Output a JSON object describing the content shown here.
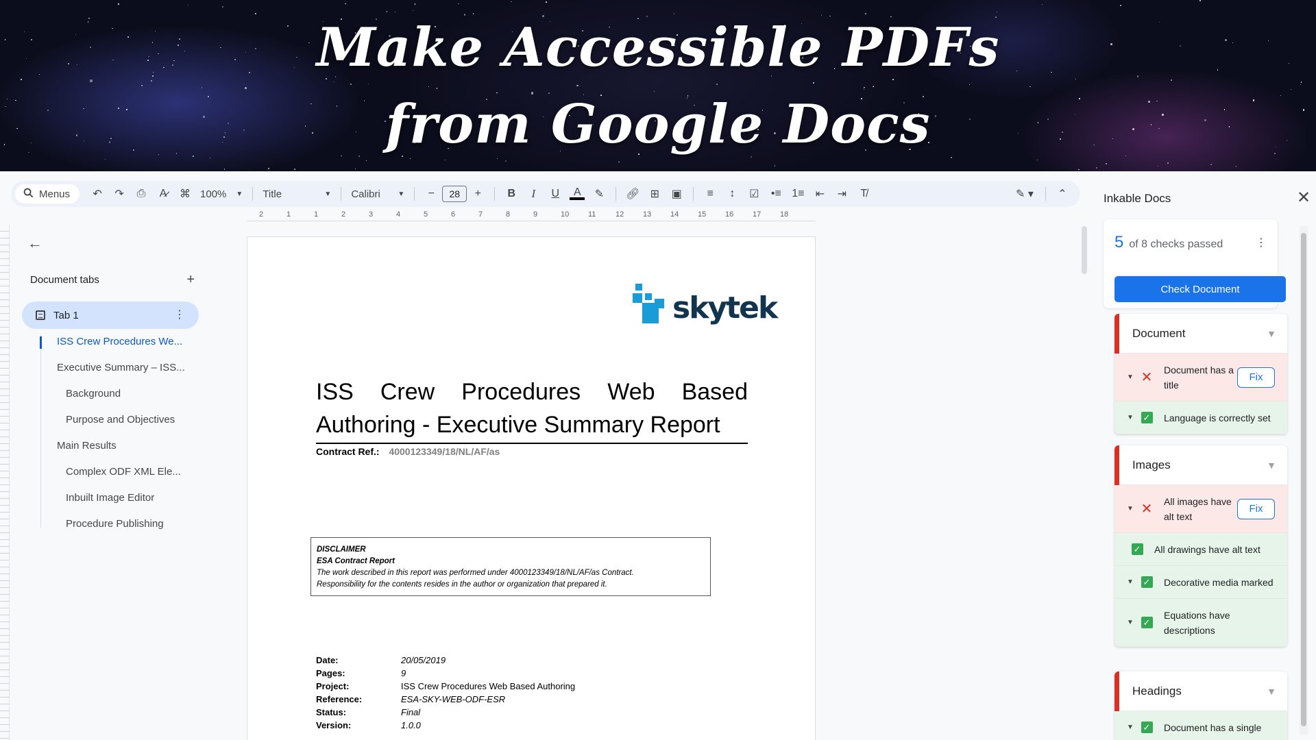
{
  "banner": {
    "line1": "Make Accessible PDFs",
    "line2": "from Google Docs"
  },
  "toolbar": {
    "search_label": "Menus",
    "zoom": "100%",
    "style": "Title",
    "font": "Calibri",
    "font_size": "28",
    "bold": "B",
    "italic": "I",
    "underline": "U",
    "text_color": "A"
  },
  "ruler": {
    "ticks": [
      "2",
      "1",
      "1",
      "2",
      "3",
      "4",
      "5",
      "6",
      "7",
      "8",
      "9",
      "10",
      "11",
      "12",
      "13",
      "14",
      "15",
      "16",
      "17",
      "18"
    ]
  },
  "outline": {
    "heading": "Document tabs",
    "tab_label": "Tab 1",
    "items": [
      {
        "label": "ISS Crew Procedures We...",
        "level": 1,
        "active": true
      },
      {
        "label": "Executive Summary – ISS...",
        "level": 1
      },
      {
        "label": "Background",
        "level": 2
      },
      {
        "label": "Purpose and Objectives",
        "level": 2
      },
      {
        "label": "Main Results",
        "level": 1
      },
      {
        "label": "Complex ODF XML Ele...",
        "level": 2
      },
      {
        "label": "Inbuilt Image Editor",
        "level": 2
      },
      {
        "label": "Procedure Publishing",
        "level": 2
      }
    ]
  },
  "document": {
    "logo_text": "skytek",
    "title_line1": "ISS Crew Procedures Web Based",
    "title_line2": "Authoring - Executive Summary Report",
    "contract_label": "Contract Ref.:",
    "contract_value": "4000123349/18/NL/AF/as",
    "disclaimer_title": "DISCLAIMER",
    "disclaimer_subtitle": "ESA Contract Report",
    "disclaimer_line1": "The work described in this report was performed under 4000123349/18/NL/AF/as Contract.",
    "disclaimer_line2": "Responsibility for the contents resides in the author or organization that prepared it.",
    "meta": [
      {
        "key": "Date:",
        "value": "20/05/2019",
        "italic": true
      },
      {
        "key": "Pages:",
        "value": "9",
        "italic": true
      },
      {
        "key": "Project:",
        "value": "ISS Crew Procedures Web Based Authoring",
        "italic": false
      },
      {
        "key": "Reference:",
        "value": "ESA-SKY-WEB-ODF-ESR",
        "italic": true
      },
      {
        "key": "Status:",
        "value": "Final",
        "italic": true
      },
      {
        "key": "Version:",
        "value": "1.0.0",
        "italic": true
      }
    ]
  },
  "panel": {
    "title": "Inkable Docs",
    "passed_count": "5",
    "passed_text": "of 8 checks passed",
    "check_button": "Check Document",
    "fix_label": "Fix",
    "sections": [
      {
        "name": "Document",
        "checks": [
          {
            "label": "Document has a title",
            "status": "fail",
            "expandable": true
          },
          {
            "label": "Language is correctly set",
            "status": "pass",
            "expandable": true
          }
        ]
      },
      {
        "name": "Images",
        "checks": [
          {
            "label": "All images have alt text",
            "status": "fail",
            "expandable": true
          },
          {
            "label": "All drawings have alt text",
            "status": "pass",
            "expandable": false
          },
          {
            "label": "Decorative media marked",
            "status": "pass",
            "expandable": true
          },
          {
            "label": "Equations have descriptions",
            "status": "pass",
            "expandable": true
          }
        ]
      },
      {
        "name": "Headings",
        "checks": [
          {
            "label": "Document has a single",
            "status": "pass",
            "expandable": true
          }
        ]
      }
    ]
  },
  "colors": {
    "accent": "#1a73e8",
    "fail": "#d93025",
    "pass": "#34a853",
    "fail_bg": "#fce8e6",
    "pass_bg": "#e6f4ea"
  }
}
